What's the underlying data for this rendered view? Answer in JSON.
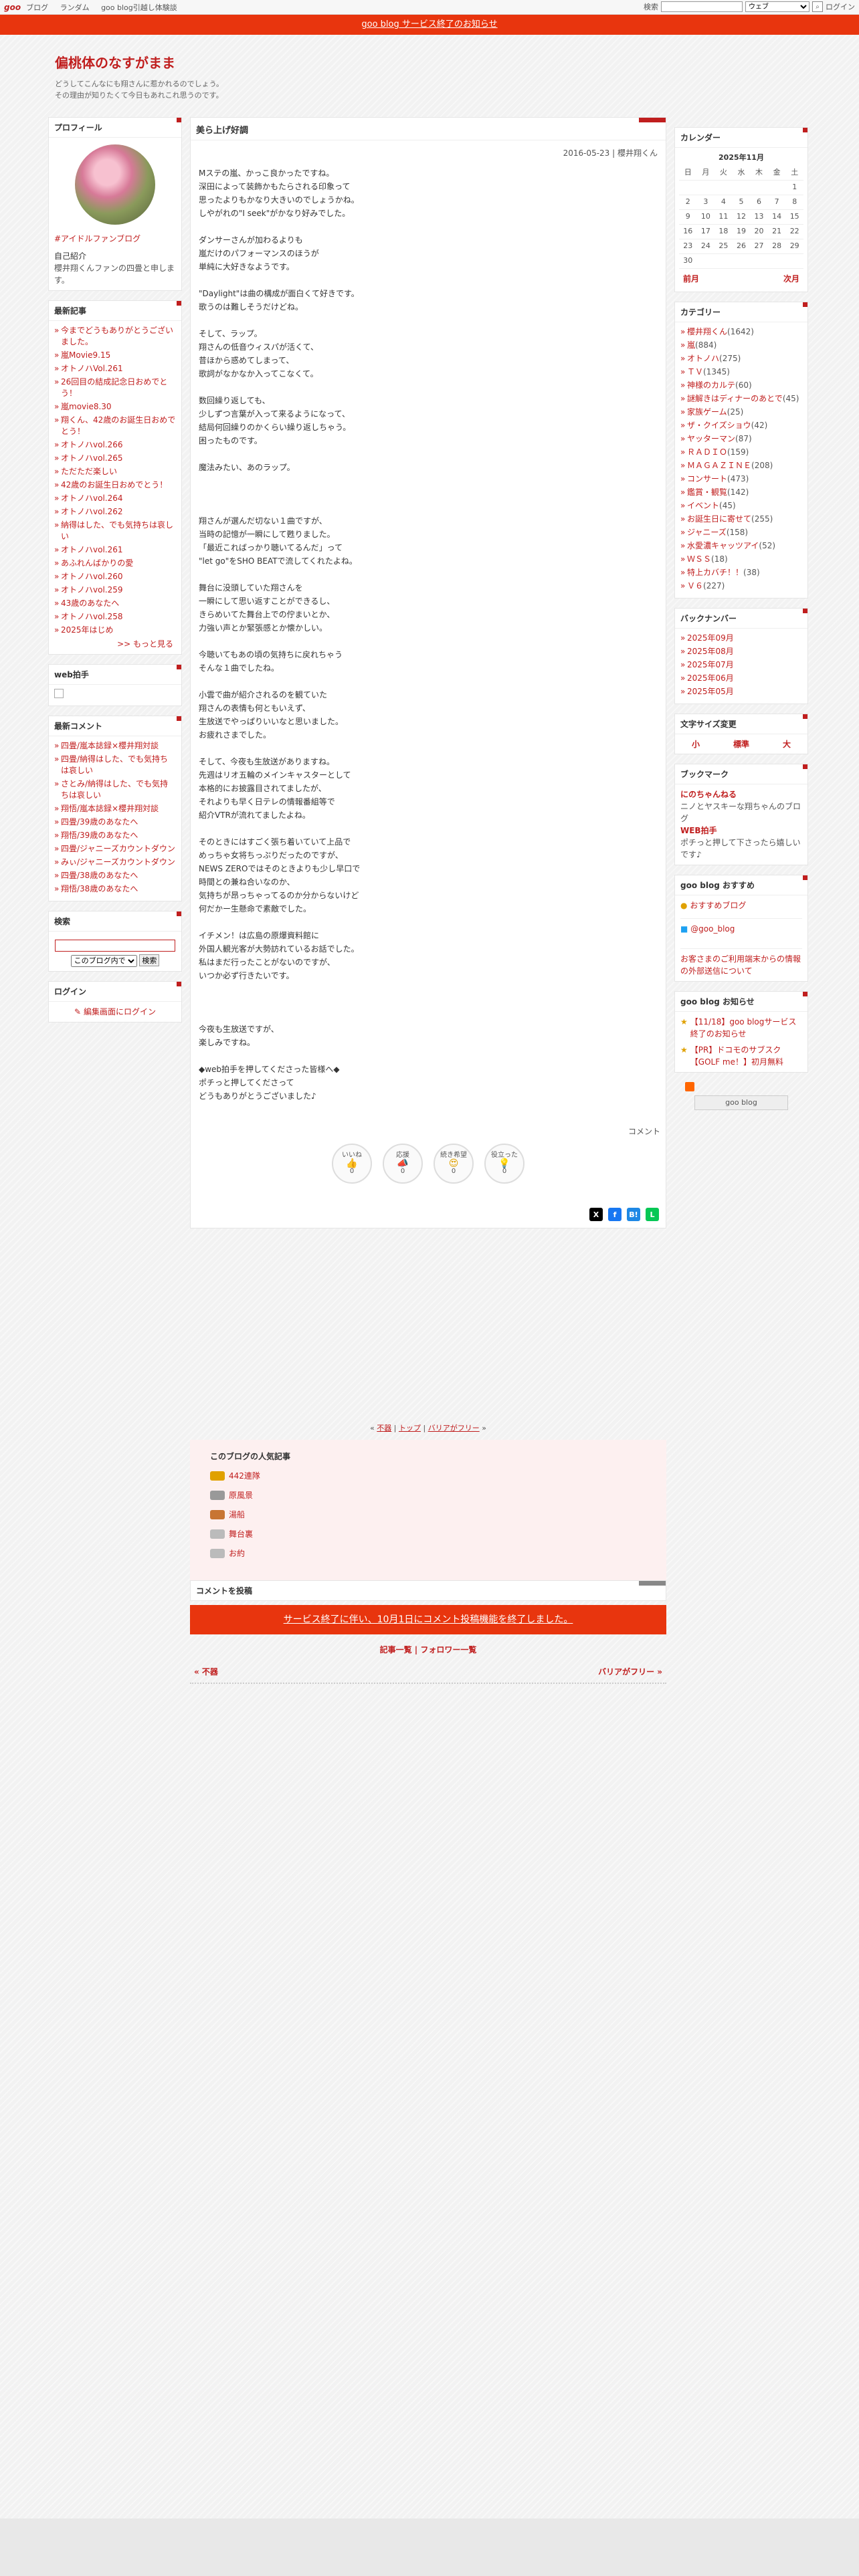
{
  "topbar": {
    "logo": "goo",
    "nav": [
      "ブログ",
      "ランダム",
      "goo blog引越し体験談"
    ],
    "search_label": "検索",
    "scope": "ウェブ",
    "login": "ログイン"
  },
  "notice": "goo blog サービス終了のお知らせ",
  "blog": {
    "title": "偏桃体のなすがまま",
    "desc1": "どうしてこんなにも翔さんに惹かれるのでしょう。",
    "desc2": "その理由が知りたくて今日もあれこれ思うのです。"
  },
  "profile": {
    "title": "プロフィール",
    "link": "#アイドルファンブログ",
    "intro_label": "自己紹介",
    "intro": "櫻井翔くんファンの四畳と申します。"
  },
  "recent": {
    "title": "最新記事",
    "items": [
      "今までどうもありがとうございました。",
      "嵐Movie9.15",
      "オトノハVol.261",
      "26回目の結成記念日おめでとう！",
      "嵐movie8.30",
      "翔くん、42歳のお誕生日おめでとう！",
      "オトノハvol.266",
      "オトノハvol.265",
      "ただただ楽しい",
      "42歳のお誕生日おめでとう！",
      "オトノハvol.264",
      "オトノハvol.262",
      "納得はした、でも気持ちは哀しい",
      "オトノハvol.261",
      "あふれんばかりの愛",
      "オトノハvol.260",
      "オトノハvol.259",
      "43歳のあなたへ",
      "オトノハvol.258",
      "2025年はじめ"
    ],
    "more": ">> もっと見る"
  },
  "webclap": {
    "title": "web拍手"
  },
  "comments": {
    "title": "最新コメント",
    "items": [
      "四畳/嵐本誌録×櫻井翔対談",
      "四畳/納得はした、でも気持ちは哀しい",
      "さとみ/納得はした、でも気持ちは哀しい",
      "翔悟/嵐本誌録×櫻井翔対談",
      "四畳/39歳のあなたへ",
      "翔悟/39歳のあなたへ",
      "四畳/ジャニーズカウントダウン",
      "みぃ/ジャニーズカウントダウン",
      "四畳/38歳のあなたへ",
      "翔悟/38歳のあなたへ"
    ]
  },
  "search": {
    "title": "検索",
    "scope": "このブログ内で",
    "button": "検索"
  },
  "login": {
    "title": "ログイン",
    "link": "編集画面にログイン"
  },
  "entry": {
    "title": "美ら上げ好調",
    "date": "2016-05-23",
    "author": "櫻井翔くん",
    "paras": [
      [
        "Mステの嵐、かっこ良かったですね。",
        "深田によって装飾かもたらされる印象って",
        "思ったよりもかなり大きいのでしょうかね。",
        "しやがれの\"I seek\"がかなり好みでした。"
      ],
      [
        "ダンサーさんが加わるよりも",
        "嵐だけのパフォーマンスのほうが",
        "単純に大好きなようです。"
      ],
      [
        "\"Daylight\"は曲の構成が面白くて好きです。",
        "歌うのは難しそうだけどね。"
      ],
      [
        "そして、ラップ。",
        "翔さんの低音ウィスパが活くて、",
        "昔ほから惑めてしまって、",
        "歌詞がなかなか入ってこなくて。"
      ],
      [
        "数回繰り返しても、",
        "少しずつ言葉が入って来るようになって、",
        "結局何回繰りのかくらい繰り返しちゃう。",
        "困ったものです。"
      ],
      [
        "魔法みたい、あのラップ。"
      ],
      [],
      [
        "翔さんが選んだ切ない１曲ですが、",
        "当時の記憶が一瞬にして甦りました。",
        "「最近こればっかり聴いてるんだ」って",
        "\"let go\"をSHO BEATで流してくれたよね。"
      ],
      [
        "舞台に没頭していた翔さんを",
        "一瞬にして思い返すことができるし、",
        "きらめいてた舞台上での佇まいとか、",
        "力強い声とか緊張感とか懐かしい。"
      ],
      [
        "今聴いてもあの頃の気持ちに戻れちゃう",
        "そんな１曲でしたね。"
      ],
      [
        "小雲で曲が紹介されるのを観ていた",
        "翔さんの表情も何ともいえず、",
        "生放送でやっぱりいいなと思いました。",
        "お疲れさまでした。"
      ],
      [
        "そして、今夜も生放送がありますね。",
        "先週はリオ五輪のメインキャスターとして",
        "本格的にお披露目されてましたが、",
        "それよりも早く日テレの情報番組等で",
        "紹介VTRが流れてましたよね。"
      ],
      [
        "そのときにはすごく張ち着いていて上品で",
        "めっちゃ女将ちっぷりだったのですが、",
        "NEWS ZEROではそのときよりも少し早口で",
        "時間との兼ね合いなのか、",
        "気持ちが昂っちゃってるのか分からないけど",
        "何だかー生懸命で素敵でした。"
      ],
      [
        "イチメン！は広島の原爆資料館に",
        "外国人観光客が大勢訪れているお話でした。",
        "私はまだ行ったことがないのですが、",
        "いつか必ず行きたいです。"
      ],
      [],
      [
        "今夜も生放送ですが、",
        "楽しみですね。"
      ],
      [
        "◆web拍手を押してくださった皆様へ◆",
        "ポチっと押してくださって",
        "どうもありがとうございました♪"
      ]
    ],
    "comment_link": "コメント",
    "reactions": [
      {
        "label": "いいね",
        "count": "0"
      },
      {
        "label": "応援",
        "count": "0"
      },
      {
        "label": "続き希望",
        "count": "0"
      },
      {
        "label": "役立った",
        "count": "0"
      }
    ]
  },
  "pager": {
    "prev": "不器",
    "top": "トップ",
    "next": "バリアがフリー"
  },
  "popular": {
    "title": "このブログの人気記事",
    "items": [
      "442連隊",
      "原風景",
      "湯船",
      "舞台裏",
      "お約"
    ]
  },
  "cpost": {
    "title": "コメントを投稿",
    "closed": "サービス終了に伴い、10月1日にコメント投稿機能を終了しました。"
  },
  "foot": {
    "list": "記事一覧",
    "follow": "フォロワー一覧",
    "prev": "« 不器",
    "next": "バリアがフリー »"
  },
  "calendar": {
    "title": "カレンダー",
    "caption": "2025年11月",
    "days": [
      "日",
      "月",
      "火",
      "水",
      "木",
      "金",
      "土"
    ],
    "weeks": [
      [
        "",
        "",
        "",
        "",
        "",
        "",
        "1"
      ],
      [
        "2",
        "3",
        "4",
        "5",
        "6",
        "7",
        "8"
      ],
      [
        "9",
        "10",
        "11",
        "12",
        "13",
        "14",
        "15"
      ],
      [
        "16",
        "17",
        "18",
        "19",
        "20",
        "21",
        "22"
      ],
      [
        "23",
        "24",
        "25",
        "26",
        "27",
        "28",
        "29"
      ],
      [
        "30",
        "",
        "",
        "",
        "",
        "",
        ""
      ]
    ],
    "prev": "前月",
    "next": "次月"
  },
  "categories": {
    "title": "カテゴリー",
    "items": [
      {
        "n": "櫻井翔くん",
        "c": "(1642)"
      },
      {
        "n": "嵐",
        "c": "(884)"
      },
      {
        "n": "オトノハ",
        "c": "(275)"
      },
      {
        "n": "ＴＶ",
        "c": "(1345)"
      },
      {
        "n": "神様のカルテ",
        "c": "(60)"
      },
      {
        "n": "謎解きはディナーのあとで",
        "c": "(45)"
      },
      {
        "n": "家族ゲーム",
        "c": "(25)"
      },
      {
        "n": "ザ・クイズショウ",
        "c": "(42)"
      },
      {
        "n": "ヤッターマン",
        "c": "(87)"
      },
      {
        "n": "ＲＡＤＩＯ",
        "c": "(159)"
      },
      {
        "n": "ＭＡＧＡＺＩＮＥ",
        "c": "(208)"
      },
      {
        "n": "コンサート",
        "c": "(473)"
      },
      {
        "n": "鑑賞・観覧",
        "c": "(142)"
      },
      {
        "n": "イベント",
        "c": "(45)"
      },
      {
        "n": "お誕生日に寄せて",
        "c": "(255)"
      },
      {
        "n": "ジャニーズ",
        "c": "(158)"
      },
      {
        "n": "水愛濃キャッツアイ",
        "c": "(52)"
      },
      {
        "n": "ＷＳＳ",
        "c": "(18)"
      },
      {
        "n": "特上カバチ！！",
        "c": "(38)"
      },
      {
        "n": "Ｖ６",
        "c": "(227)"
      }
    ]
  },
  "backnumber": {
    "title": "バックナンバー",
    "items": [
      "2025年09月",
      "2025年08月",
      "2025年07月",
      "2025年06月",
      "2025年05月"
    ]
  },
  "fontsize": {
    "title": "文字サイズ変更",
    "small": "小",
    "normal": "標準",
    "large": "大"
  },
  "bookmark": {
    "title": "ブックマーク",
    "b1": "にのちゃんねる",
    "b1d": "ニノとヤスキーな翔ちゃんのブログ",
    "b2": "WEB拍手",
    "b2d": "ポチっと押して下さったら嬉しいです♪"
  },
  "recommend": {
    "title": "goo blog おすすめ",
    "l1": "おすすめブログ",
    "l2": "@goo_blog",
    "note": "お客さまのご利用端末からの情報の外部送信について"
  },
  "gnews": {
    "title": "goo blog お知らせ",
    "n1": "【11/18】goo blogサービス終了のお知らせ",
    "n2": "【PR】ドコモのサブスク【GOLF me！】初月無料"
  },
  "gbtn": "goo blog",
  "colors": {
    "accent": "#c01e1e",
    "notice": "#e8350e"
  }
}
